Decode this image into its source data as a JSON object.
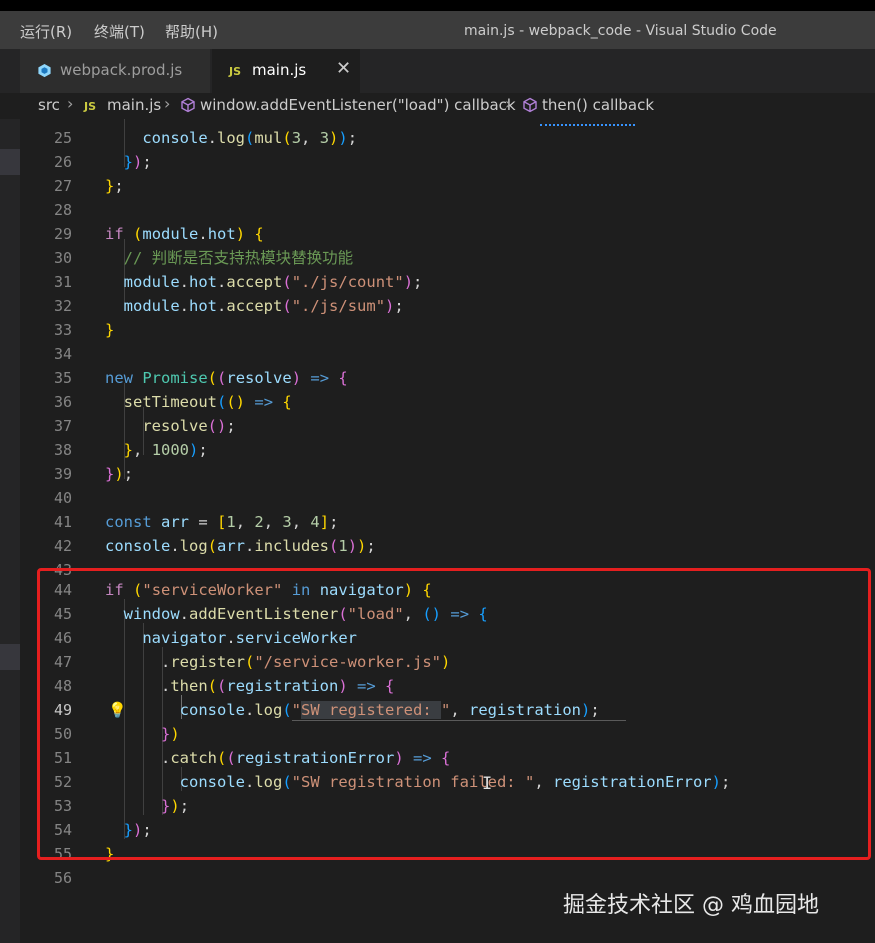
{
  "menu": {
    "run": "运行(R)",
    "terminal": "终端(T)",
    "help": "帮助(H)"
  },
  "window": {
    "title": "main.js - webpack_code - Visual Studio Code"
  },
  "tabs": [
    {
      "label": "webpack.prod.js",
      "icon": "webpack-icon",
      "active": false
    },
    {
      "label": "main.js",
      "icon": "js-file-icon",
      "active": true,
      "close_glyph": "✕"
    }
  ],
  "breadcrumbs": {
    "folder": "src",
    "file_icon": "JS",
    "file": "main.js",
    "item1": "window.addEventListener(\"load\") callback",
    "item2": "then() callback",
    "separator": "›"
  },
  "editor": {
    "active_line": 49,
    "lines": [
      {
        "n": "25",
        "text": "    console.log(mul(3, 3));"
      },
      {
        "n": "26",
        "text": "  });"
      },
      {
        "n": "27",
        "text": "};"
      },
      {
        "n": "28",
        "text": ""
      },
      {
        "n": "29",
        "text": "if (module.hot) {"
      },
      {
        "n": "30",
        "text": "  // 判断是否支持热模块替换功能"
      },
      {
        "n": "31",
        "text": "  module.hot.accept(\"./js/count\");"
      },
      {
        "n": "32",
        "text": "  module.hot.accept(\"./js/sum\");"
      },
      {
        "n": "33",
        "text": "}"
      },
      {
        "n": "34",
        "text": ""
      },
      {
        "n": "35",
        "text": "new Promise((resolve) => {"
      },
      {
        "n": "36",
        "text": "  setTimeout(() => {"
      },
      {
        "n": "37",
        "text": "    resolve();"
      },
      {
        "n": "38",
        "text": "  }, 1000);"
      },
      {
        "n": "39",
        "text": "});"
      },
      {
        "n": "40",
        "text": ""
      },
      {
        "n": "41",
        "text": "const arr = [1, 2, 3, 4];"
      },
      {
        "n": "42",
        "text": "console.log(arr.includes(1));"
      },
      {
        "n": "43",
        "text": ""
      },
      {
        "n": "44",
        "text": "if (\"serviceWorker\" in navigator) {"
      },
      {
        "n": "45",
        "text": "  window.addEventListener(\"load\", () => {"
      },
      {
        "n": "46",
        "text": "    navigator.serviceWorker"
      },
      {
        "n": "47",
        "text": "      .register(\"/service-worker.js\")"
      },
      {
        "n": "48",
        "text": "      .then((registration) => {"
      },
      {
        "n": "49",
        "text": "        console.log(\"SW registered: \", registration);"
      },
      {
        "n": "50",
        "text": "      })"
      },
      {
        "n": "51",
        "text": "      .catch((registrationError) => {"
      },
      {
        "n": "52",
        "text": "        console.log(\"SW registration failed: \", registrationError);"
      },
      {
        "n": "53",
        "text": "      });"
      },
      {
        "n": "54",
        "text": "  });"
      },
      {
        "n": "55",
        "text": "}"
      },
      {
        "n": "56",
        "text": ""
      }
    ]
  },
  "lightbulb_icon": "lightbulb-icon",
  "watermark": "掘金技术社区 @ 鸡血园地",
  "colors": {
    "highlight_box": "#e51f1f",
    "editor_bg": "#1e1e1e",
    "keyword": "#569cd6",
    "string": "#ce9178"
  }
}
